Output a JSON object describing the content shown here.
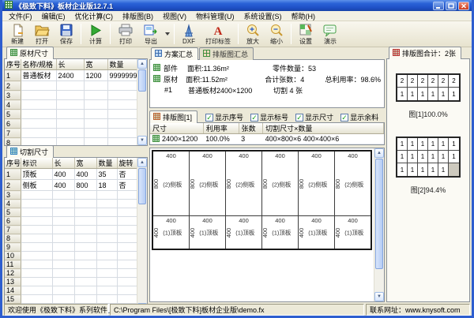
{
  "window": {
    "title": "《极致下料》板材企业版12.7.1"
  },
  "menu": {
    "items": [
      "文件(F)",
      "编辑(E)",
      "优化计算(C)",
      "排版图(B)",
      "视图(V)",
      "物料管理(U)",
      "系统设置(S)",
      "帮助(H)"
    ]
  },
  "toolbar": {
    "buttons": [
      {
        "id": "new",
        "label": "新建"
      },
      {
        "id": "open",
        "label": "打开"
      },
      {
        "id": "save",
        "label": "保存"
      },
      {
        "id": "calc",
        "label": "计算"
      },
      {
        "id": "print",
        "label": "打印"
      },
      {
        "id": "export",
        "label": "导出"
      },
      {
        "id": "dxf",
        "label": "DXF"
      },
      {
        "id": "print-label",
        "label": "打印标签"
      },
      {
        "id": "zoom-in",
        "label": "放大"
      },
      {
        "id": "zoom-out",
        "label": "缩小"
      },
      {
        "id": "settings",
        "label": "设置"
      },
      {
        "id": "demo",
        "label": "演示"
      }
    ]
  },
  "left": {
    "raw": {
      "tab": "原材尺寸",
      "headers": [
        "序号",
        "名称/规格",
        "长",
        "宽",
        "数量"
      ],
      "rows": [
        [
          "普通板材",
          "2400",
          "1200",
          "99999999"
        ]
      ],
      "visible_rows": 8
    },
    "cut": {
      "tab": "切割尺寸",
      "headers": [
        "序号",
        "标识",
        "长",
        "宽",
        "数量",
        "旋转"
      ],
      "rows": [
        [
          "顶板",
          "400",
          "400",
          "35",
          "否"
        ],
        [
          "侧板",
          "400",
          "800",
          "18",
          "否"
        ]
      ],
      "visible_rows": 16
    }
  },
  "center": {
    "tabs": [
      {
        "label": "方案汇总"
      },
      {
        "label": "排版图汇总"
      }
    ],
    "summary": {
      "lines": [
        {
          "name": "部件",
          "c1": "面积:11.36m²",
          "c2": "零件数量：53",
          "c3": ""
        },
        {
          "name": "原材",
          "c1": "面积:11.52m²",
          "c2": "合计张数：4",
          "c3": "总利用率：98.6%"
        },
        {
          "name": "#1",
          "c1": "普通板材2400×1200",
          "c2": "切割 4 张",
          "c3": ""
        }
      ]
    },
    "layout": {
      "tab": "排版图[1]",
      "checkboxes": [
        "显示序号",
        "显示标号",
        "显示尺寸",
        "显示余料"
      ],
      "table": {
        "headers": [
          "尺寸",
          "利用率",
          "张数",
          "切割尺寸×数量"
        ],
        "rows": [
          [
            "2400×1200",
            "100.0%",
            "3",
            "400×800×6 400×400×6"
          ]
        ]
      },
      "drawing": {
        "rows": [
          {
            "cells": 6,
            "top": "400",
            "side": "800",
            "part": "(2)侧板",
            "kind": "tall"
          },
          {
            "cells": 6,
            "top": "400",
            "side": "400",
            "part": "(1)顶板",
            "kind": "short"
          }
        ]
      }
    }
  },
  "right": {
    "tab": "排版图合计：2张",
    "thumbs": [
      {
        "caption": "图[1]100.0%",
        "grid": [
          [
            "2",
            "2",
            "2",
            "2",
            "2",
            "2"
          ],
          [
            "1",
            "1",
            "1",
            "1",
            "1",
            "1"
          ]
        ]
      },
      {
        "caption": "图[2]94.4%",
        "grid": [
          [
            "1",
            "1",
            "1",
            "1",
            "1",
            "1"
          ],
          [
            "1",
            "1",
            "1",
            "1",
            "1",
            "1"
          ],
          [
            "1",
            "1",
            "1",
            "1",
            "1",
            ""
          ]
        ]
      }
    ]
  },
  "statusbar": {
    "welcome": "欢迎使用《极致下料》系列软件。",
    "path": "C:\\Program Files\\[极致下料]板材企业版\\demo.fx",
    "contact": "联系网址：www.knysoft.com"
  }
}
